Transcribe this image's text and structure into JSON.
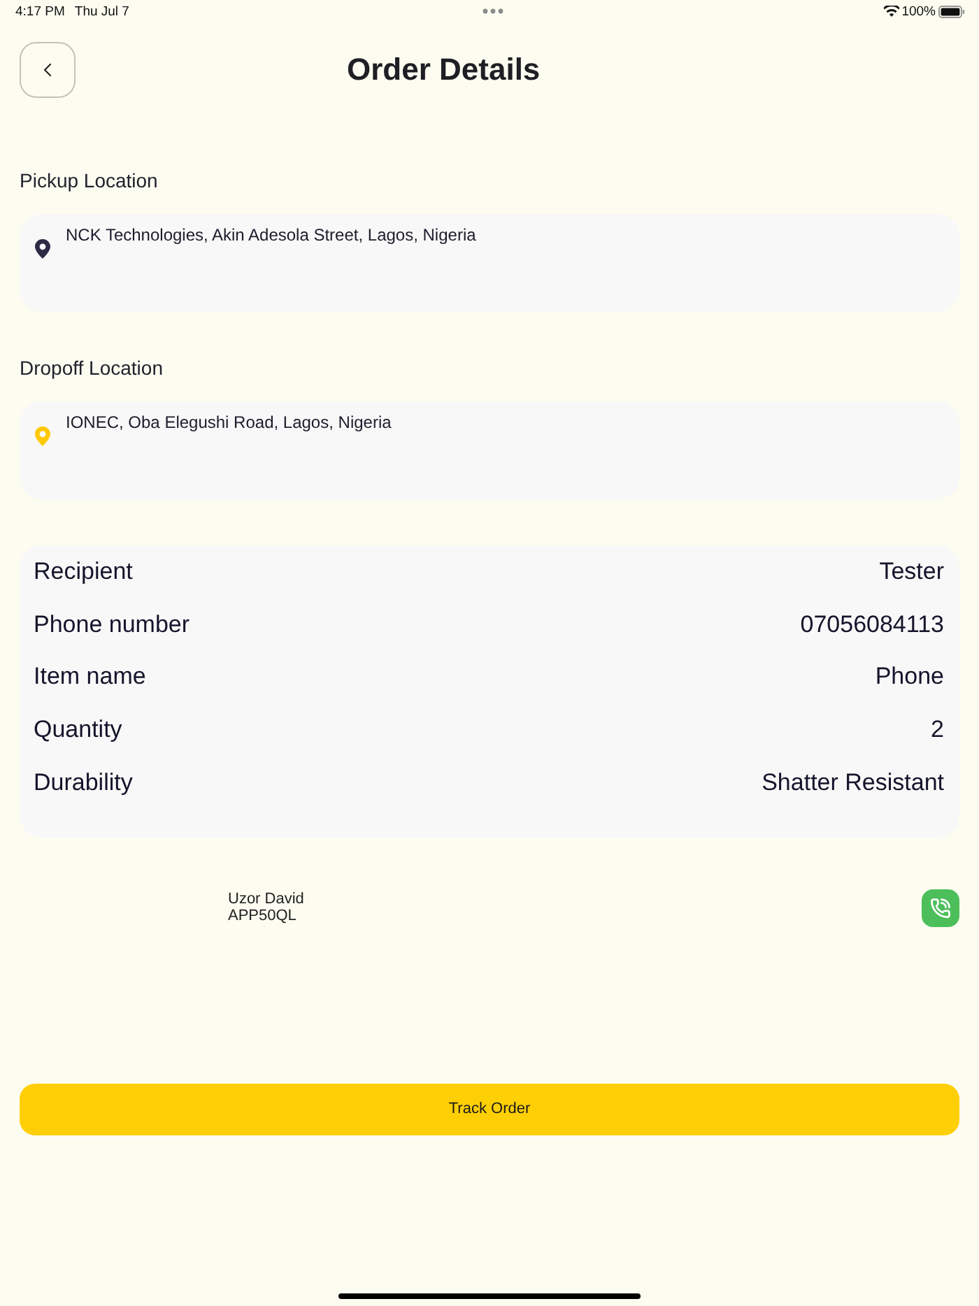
{
  "status_bar": {
    "time": "4:17 PM",
    "date": "Thu Jul 7",
    "battery": "100%"
  },
  "header": {
    "title": "Order Details"
  },
  "locations": [
    {
      "label": "Pickup Location",
      "address": "NCK Technologies, Akin Adesola Street, Lagos, Nigeria",
      "color": "#2b2b45"
    },
    {
      "label": "Dropoff Location",
      "address": "IONEC, Oba Elegushi Road, Lagos, Nigeria",
      "color": "#ffc907"
    }
  ],
  "details": [
    {
      "label": "Recipient",
      "value": "Tester"
    },
    {
      "label": "Phone number",
      "value": "07056084113"
    },
    {
      "label": "Item name",
      "value": "Phone"
    },
    {
      "label": "Quantity",
      "value": "2"
    },
    {
      "label": "Durability",
      "value": "Shatter Resistant"
    }
  ],
  "driver": {
    "name": "Uzor David",
    "plate": "APP50QL"
  },
  "primary_button": {
    "label": "Track Order"
  }
}
